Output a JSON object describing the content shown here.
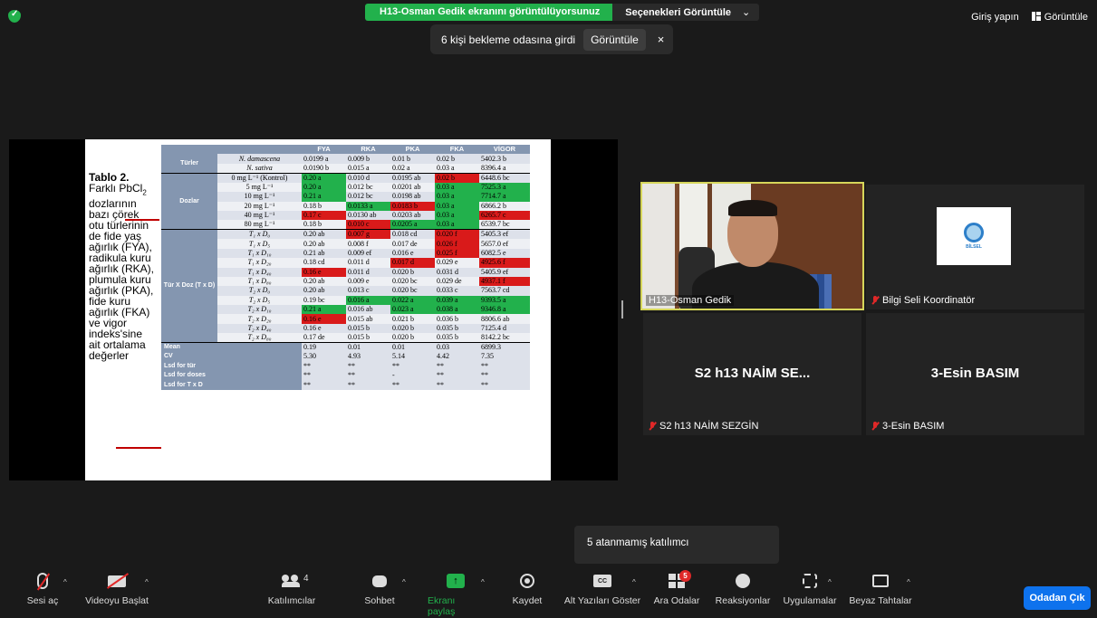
{
  "top": {
    "share_banner": "H13-Osman Gedik ekranını görüntülüyorsunuz",
    "view_options": "Seçenekleri Görüntüle",
    "view_options_caret": "⌄",
    "sign_in": "Giriş yapın",
    "view": "Görüntüle"
  },
  "notification": {
    "text": "6 kişi bekleme odasına girdi",
    "button": "Görüntüle",
    "close": "×"
  },
  "slide": {
    "caption_title": "Tablo 2.",
    "caption_lines": [
      "Farklı PbCl",
      "dozlarının",
      "bazı çörek",
      "otu türlerinin",
      "de fide yaş",
      "ağırlık (FYA),",
      "radikula kuru",
      "ağırlık (RKA),",
      "plumula kuru",
      "ağırlık (PKA),",
      "fide kuru",
      "ağırlık (FKA)",
      "ve vigor",
      "indeks'sine",
      "ait ortalama",
      "değerler"
    ],
    "caption_sub": "2",
    "headers": [
      "FYA",
      "RKA",
      "PKA",
      "FKA",
      "VİGOR"
    ],
    "group_turler": "Türler",
    "group_dozlar": "Dozlar",
    "group_txd": "Tür X Doz (T x D)",
    "rows": [
      {
        "label": "N. damascena",
        "vals": [
          "0.0199 a",
          "0.009 b",
          "0.01 b",
          "0.02 b",
          "5402.3 b"
        ],
        "marks": [
          "",
          "",
          "",
          "",
          ""
        ]
      },
      {
        "label": "N. sativa",
        "vals": [
          "0.0190 b",
          "0.015 a",
          "0.02 a",
          "0.03 a",
          "8396.4 a"
        ],
        "marks": [
          "",
          "",
          "",
          "",
          ""
        ]
      },
      {
        "label": "0 mg L⁻¹ (Kontrol)",
        "vals": [
          "0.20 a",
          "0.010 d",
          "0.0195 ab",
          "0.02 b",
          "6448.6 bc"
        ],
        "marks": [
          "g",
          "",
          "",
          "r",
          ""
        ]
      },
      {
        "label": "5 mg L⁻¹",
        "vals": [
          "0.20 a",
          "0.012 bc",
          "0.0201 ab",
          "0.03 a",
          "7525.3 a"
        ],
        "marks": [
          "g",
          "",
          "",
          "g",
          "g"
        ]
      },
      {
        "label": "10 mg L⁻¹",
        "vals": [
          "0.21 a",
          "0.012 bc",
          "0.0198 ab",
          "0.03 a",
          "7714.7 a"
        ],
        "marks": [
          "g",
          "",
          "",
          "g",
          "g"
        ]
      },
      {
        "label": "20 mg L⁻¹",
        "vals": [
          "0.18 b",
          "0.0133 a",
          "0.0183 b",
          "0.03 a",
          "6866.2 b"
        ],
        "marks": [
          "",
          "g",
          "r",
          "g",
          ""
        ]
      },
      {
        "label": "40 mg L⁻¹",
        "vals": [
          "0.17 c",
          "0.0130 ab",
          "0.0203 ab",
          "0.03 a",
          "6265.7 c"
        ],
        "marks": [
          "r",
          "",
          "",
          "g",
          "r"
        ]
      },
      {
        "label": "80 mg L⁻¹",
        "vals": [
          "0.18 b",
          "0.010 c",
          "0.0205 a",
          "0.03 a",
          "6539.7 bc"
        ],
        "marks": [
          "",
          "r",
          "g",
          "g",
          ""
        ]
      },
      {
        "label": "T₁ x D₀",
        "vals": [
          "0.20 ab",
          "0.007 g",
          "0.018 cd",
          "0.020 f",
          "5405.3 ef"
        ],
        "marks": [
          "",
          "r",
          "",
          "r",
          ""
        ]
      },
      {
        "label": "T₁ x D₅",
        "vals": [
          "0.20 ab",
          "0.008 f",
          "0.017 de",
          "0.026 f",
          "5657.0 ef"
        ],
        "marks": [
          "",
          "",
          "",
          "r",
          ""
        ]
      },
      {
        "label": "T₁ x D₁₀",
        "vals": [
          "0.21 ab",
          "0.009 ef",
          "0.016 e",
          "0.025 f",
          "6082.5 e"
        ],
        "marks": [
          "",
          "",
          "",
          "r",
          ""
        ]
      },
      {
        "label": "T₁ x D₂₀",
        "vals": [
          "0.18 cd",
          "0.011 d",
          "0.017 d",
          "0.029 e",
          "4925.6 f"
        ],
        "marks": [
          "",
          "",
          "r",
          "",
          "r"
        ]
      },
      {
        "label": "T₁ x D₄₀",
        "vals": [
          "0.16 e",
          "0.011 d",
          "0.020 b",
          "0.031 d",
          "5405.9 ef"
        ],
        "marks": [
          "r",
          "",
          "",
          "",
          ""
        ]
      },
      {
        "label": "T₁ x D₈₀",
        "vals": [
          "0.20 ab",
          "0.009 e",
          "0.020 bc",
          "0.029 de",
          "4937.1 f"
        ],
        "marks": [
          "",
          "",
          "",
          "",
          "r"
        ]
      },
      {
        "label": "T₂ x D₀",
        "vals": [
          "0.20 ab",
          "0.013 c",
          "0.020 bc",
          "0.033 c",
          "7563.7 cd"
        ],
        "marks": [
          "",
          "",
          "",
          "",
          ""
        ]
      },
      {
        "label": "T₂ x D₅",
        "vals": [
          "0.19 bc",
          "0.016 a",
          "0.022 a",
          "0.039 a",
          "9393.5 a"
        ],
        "marks": [
          "",
          "g",
          "g",
          "g",
          "g"
        ]
      },
      {
        "label": "T₂ x D₁₀",
        "vals": [
          "0.21 a",
          "0.016 ab",
          "0.023 a",
          "0.038 a",
          "9346.8 a"
        ],
        "marks": [
          "g",
          "",
          "g",
          "g",
          "g"
        ]
      },
      {
        "label": "T₂ x D₂₀",
        "vals": [
          "0.16 e",
          "0.015 ab",
          "0.021 b",
          "0.036 b",
          "8806.6 ab"
        ],
        "marks": [
          "r",
          "",
          "",
          "",
          ""
        ]
      },
      {
        "label": "T₂ x D₄₀",
        "vals": [
          "0.16 e",
          "0.015 b",
          "0.020 b",
          "0.035 b",
          "7125.4 d"
        ],
        "marks": [
          "",
          "",
          "",
          "",
          ""
        ]
      },
      {
        "label": "T₂ x D₈₀",
        "vals": [
          "0.17 de",
          "0.015 b",
          "0.020 b",
          "0.035 b",
          "8142.2 bc"
        ],
        "marks": [
          "",
          "",
          "",
          "",
          ""
        ]
      }
    ],
    "summary": [
      {
        "label": "Mean",
        "vals": [
          "0.19",
          "0.01",
          "0.01",
          "0.03",
          "6899.3"
        ]
      },
      {
        "label": "CV",
        "vals": [
          "5.30",
          "4.93",
          "5.14",
          "4.42",
          "7.35"
        ]
      },
      {
        "label": "Lsd for tür",
        "vals": [
          "**",
          "**",
          "**",
          "**",
          "**"
        ]
      },
      {
        "label": "Lsd for doses",
        "vals": [
          "**",
          "**",
          "-",
          "**",
          "**"
        ]
      },
      {
        "label": "Lsd for T x D",
        "vals": [
          "**",
          "**",
          "**",
          "**",
          "**"
        ]
      }
    ]
  },
  "participants": {
    "osman": "H13-Osman Gedik",
    "bilgi": "Bilgi Seli Koordinatör",
    "bilgi_logo": "BİLSEL",
    "naim_short": "S2 h13 NAİM SE...",
    "naim_full": "S2 h13 NAİM SEZGİN",
    "esin_short": "3-Esin BASIM",
    "esin_full": "3-Esin BASIM"
  },
  "tooltip": "5 atanmamış katılımcı",
  "toolbar": {
    "audio": "Sesi aç",
    "video": "Videoyu Başlat",
    "participants": "Katılımcılar",
    "participants_count": "4",
    "chat": "Sohbet",
    "share": "Ekranı paylaş",
    "share_icon": "↑",
    "record": "Kaydet",
    "cc": "Alt Yazıları Göster",
    "cc_icon": "CC",
    "rooms": "Ara Odalar",
    "rooms_badge": "5",
    "reactions": "Reaksiyonlar",
    "apps": "Uygulamalar",
    "whiteboard": "Beyaz Tahtalar",
    "leave": "Odadan Çık",
    "caret": "^"
  },
  "colors": {
    "green": "#22b14c",
    "red": "#d91a1a",
    "table_header": "#8496b0",
    "leave": "#0e72ed"
  }
}
